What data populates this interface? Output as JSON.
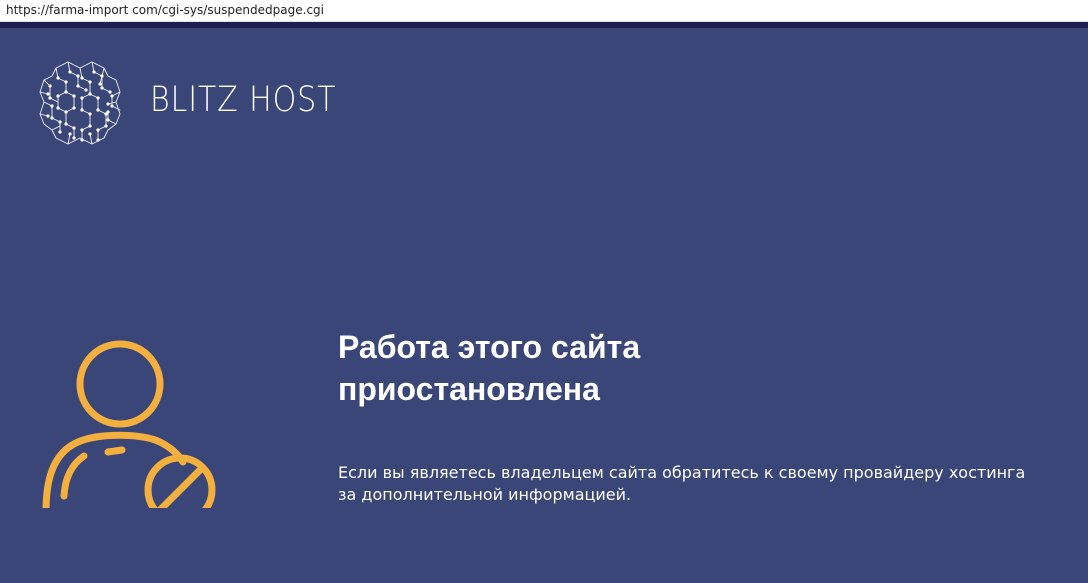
{
  "browser": {
    "address_url": "https://farma-import com/cgi-sys/suspendedpage.cgi"
  },
  "brand": {
    "logo_icon": "brain-circuit-icon",
    "name": "BLITZ HOST"
  },
  "notice": {
    "icon": "user-blocked-icon",
    "title_line1": "Работа этого сайта",
    "title_line2": "приостановлена",
    "message_line1": "Если вы являетесь владельцем сайта обратитесь к своему провайдеру хостинга",
    "message_line2": "за дополнительной информацией."
  },
  "colors": {
    "background": "#3a4677",
    "top_stripe": "#1d1e52",
    "icon_accent": "#f4b03e",
    "text": "#ffffff"
  }
}
